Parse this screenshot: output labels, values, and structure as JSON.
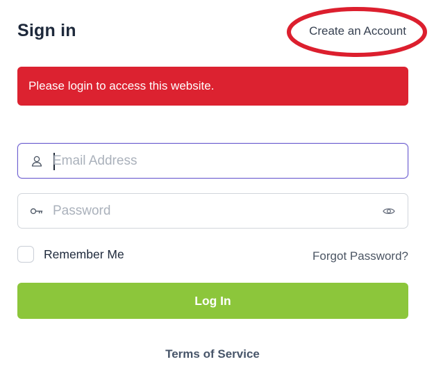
{
  "header": {
    "title": "Sign in",
    "create_account_label": "Create an Account",
    "highlight_color": "#dc1f2e"
  },
  "alert": {
    "message": "Please login to access this website.",
    "color": "#dc2230"
  },
  "form": {
    "email": {
      "placeholder": "Email Address",
      "value": "",
      "icon": "user-icon",
      "focused": true
    },
    "password": {
      "placeholder": "Password",
      "value": "",
      "icon": "key-icon",
      "toggle_icon": "eye-icon"
    },
    "remember_label": "Remember Me",
    "remember_checked": false,
    "forgot_label": "Forgot Password?",
    "submit_label": "Log In",
    "submit_color": "#8cc63b"
  },
  "footer": {
    "terms_label": "Terms of Service"
  }
}
